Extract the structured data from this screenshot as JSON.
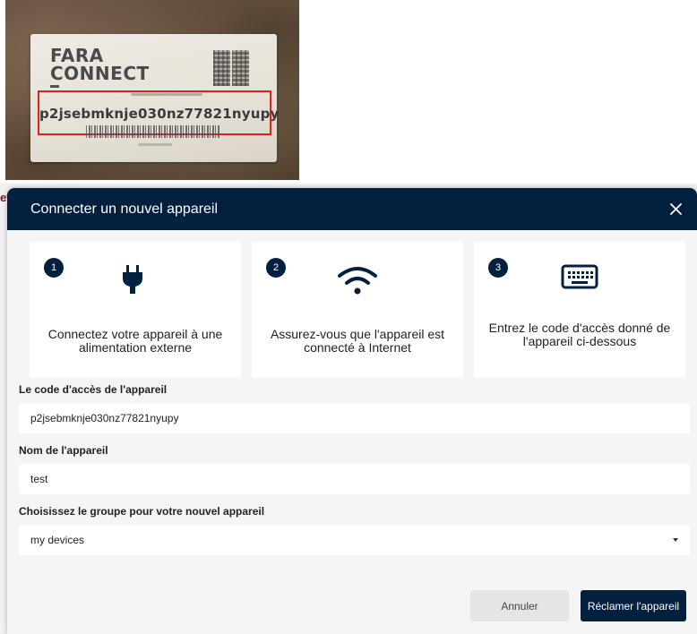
{
  "photo": {
    "brand_line1": "FARA",
    "brand_line2": "CONNECT",
    "code": "p2jsebmknje030nz77821nyupy"
  },
  "background": {
    "partial_text": "ev"
  },
  "modal": {
    "title": "Connecter un nouvel appareil",
    "close_icon": "close-icon",
    "steps": [
      {
        "number": "1",
        "icon": "plug-icon",
        "text": "Connectez votre appareil à une alimentation externe"
      },
      {
        "number": "2",
        "icon": "wifi-icon",
        "text": "Assurez-vous que l'appareil est connecté à Internet"
      },
      {
        "number": "3",
        "icon": "keyboard-icon",
        "text": "Entrez le code d'accès donné de l'appareil ci-dessous"
      }
    ],
    "fields": {
      "access_code": {
        "label": "Le code d'accès de l'appareil",
        "value": "p2jsebmknje030nz77821nyupy"
      },
      "device_name": {
        "label": "Nom de l'appareil",
        "value": "test"
      },
      "group": {
        "label": "Choisissez le groupe pour votre nouvel appareil",
        "value": "my devices"
      }
    },
    "buttons": {
      "cancel": "Annuler",
      "claim": "Réclamer l'appareil"
    }
  },
  "colors": {
    "header_bg": "#04203f",
    "highlight_box": "#e2231a",
    "modal_bg": "#f5f5f5"
  }
}
